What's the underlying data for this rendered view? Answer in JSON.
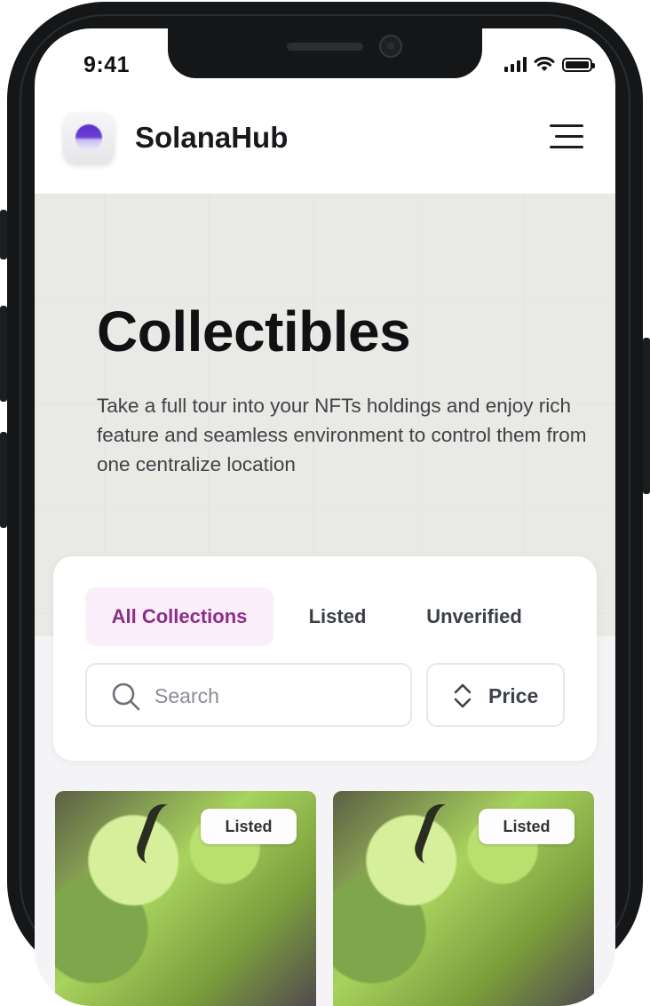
{
  "status_bar": {
    "time": "9:41"
  },
  "header": {
    "app_name": "SolanaHub",
    "logo_icon": "solana-hub-logo-icon",
    "menu_icon": "hamburger-menu-icon"
  },
  "hero": {
    "title": "Collectibles",
    "description": "Take a full tour into your NFTs holdings and enjoy rich feature and seamless environment to control them from one centralize location"
  },
  "filters": {
    "tabs": [
      {
        "label": "All Collections",
        "active": true
      },
      {
        "label": "Listed",
        "active": false
      },
      {
        "label": "Unverified",
        "active": false
      }
    ],
    "search": {
      "placeholder": "Search",
      "value": ""
    },
    "sort": {
      "label": "Price",
      "icon": "sort-updown-icon"
    }
  },
  "nft_cards": [
    {
      "badge": "Listed"
    },
    {
      "badge": "Listed"
    }
  ],
  "colors": {
    "active_tab_bg": "#fbeefa",
    "active_tab_text": "#8a2e86",
    "hero_bg": "#e9e9e5",
    "logo_purple": "#5b2fc9"
  }
}
